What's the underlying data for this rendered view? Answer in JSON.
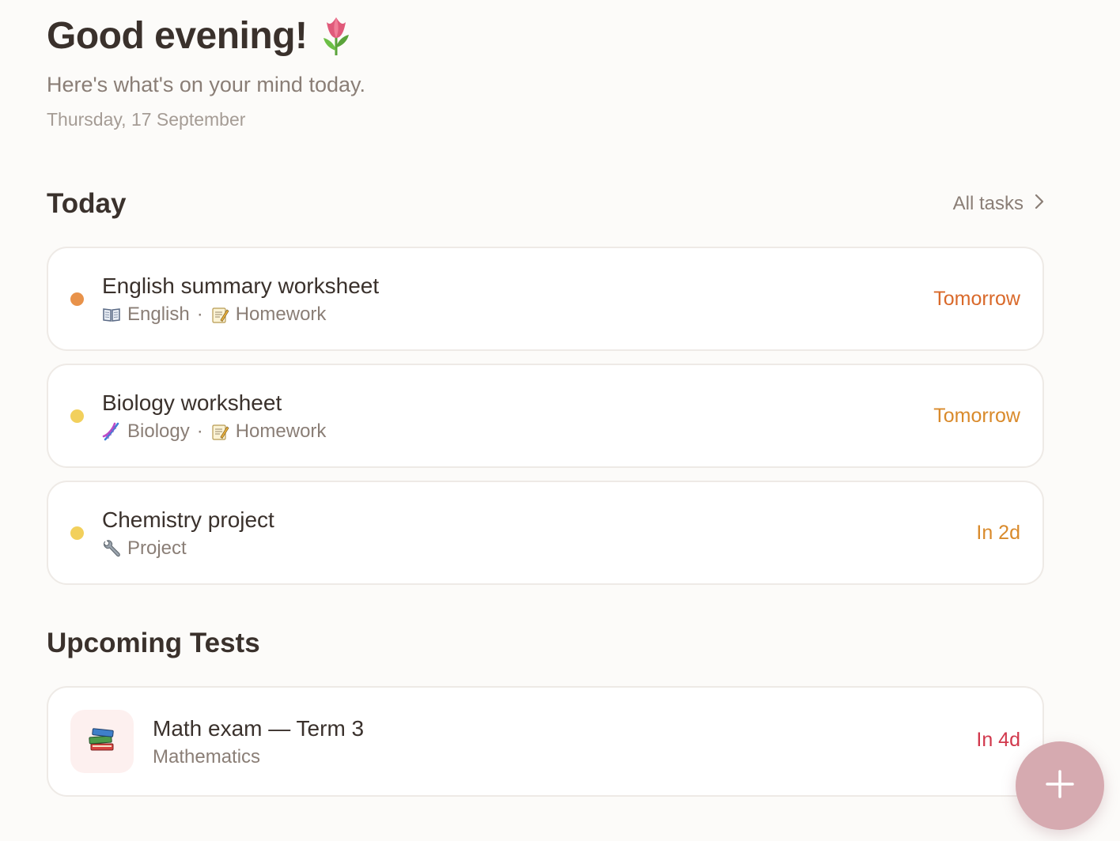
{
  "header": {
    "greeting": "Good evening!",
    "greeting_icon": "tulip-icon",
    "subtitle": "Here's what's on your mind today.",
    "date": "Thursday, 17 September"
  },
  "today": {
    "title": "Today",
    "all_tasks_label": "All tasks",
    "tasks": [
      {
        "title": "English summary worksheet",
        "subject_icon": "open-book-icon",
        "subject": "English",
        "separator": "·",
        "type_icon": "memo-icon",
        "type": "Homework",
        "due": "Tomorrow",
        "dot_color": "#e8924a",
        "due_color": "#d9692a"
      },
      {
        "title": "Biology worksheet",
        "subject_icon": "dna-icon",
        "subject": "Biology",
        "separator": "·",
        "type_icon": "memo-icon",
        "type": "Homework",
        "due": "Tomorrow",
        "dot_color": "#f2d05c",
        "due_color": "#d98a2b"
      },
      {
        "title": "Chemistry project",
        "type_icon": "wrench-icon",
        "type": "Project",
        "due": "In 2d",
        "dot_color": "#f2d05c",
        "due_color": "#d98a2b"
      }
    ]
  },
  "upcoming_tests": {
    "title": "Upcoming Tests",
    "tests": [
      {
        "icon": "books-icon",
        "title": "Math exam — Term 3",
        "subject": "Mathematics",
        "due": "In 4d",
        "due_color": "#d1384c"
      }
    ]
  },
  "fab": {
    "icon": "plus-icon",
    "color": "#d6aab0"
  }
}
